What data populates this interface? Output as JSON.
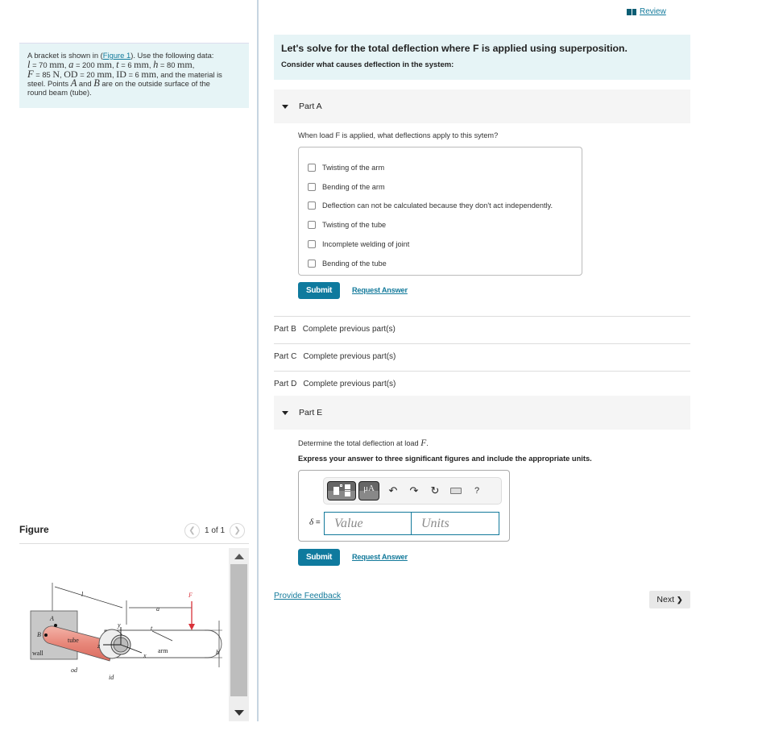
{
  "problem": {
    "prefix": "A bracket is shown in (",
    "figure_link": "Figure 1",
    "suffix": "). Use the following data:",
    "line2": [
      {
        "sym": "l",
        "val": " = 70 ",
        "unit": "mm",
        "sep": ", "
      },
      {
        "sym": "a",
        "val": " = 200 ",
        "unit": "mm",
        "sep": ", "
      },
      {
        "sym": "t",
        "val": " = 6 ",
        "unit": "mm",
        "sep": ", "
      },
      {
        "sym": "h",
        "val": " = 80 ",
        "unit": "mm",
        "sep": ","
      }
    ],
    "F_sym": "F",
    "F_val": " = 85 ",
    "F_unit": "N",
    "OD_sym": "OD",
    "OD_val": " = 20 ",
    "OD_unit": "mm",
    "ID_sym": "ID",
    "ID_val": " = 6 ",
    "ID_unit": "mm",
    "line3_tail": ", and the material is",
    "line4_a": "steel. Points ",
    "A_sym": "A",
    "and": " and ",
    "B_sym": "B",
    "line4_b": " are on the outside surface of the",
    "line5": "round beam (tube)."
  },
  "figure": {
    "title": "Figure",
    "counter": "1 of 1",
    "labels": {
      "wall": "wall",
      "tube": "tube",
      "arm": "arm",
      "A": "A",
      "B": "B",
      "l": "l",
      "a": "a",
      "F": "F",
      "t": "t",
      "h": "h",
      "y": "y",
      "x": "x",
      "z": "z",
      "od": "od",
      "id": "id"
    }
  },
  "header": {
    "review_label": "Review"
  },
  "intro": {
    "title": "Let's solve for the total deflection where F is applied using superposition.",
    "subtitle": "Consider what causes deflection in the system:"
  },
  "partA": {
    "label": "Part A",
    "question": "When load F is applied, what deflections apply to this sytem?",
    "choices": [
      {
        "label": "Twisting of the arm",
        "checked": false
      },
      {
        "label": "Bending of the arm",
        "checked": false
      },
      {
        "label": "Deflection can not be calculated because they don't act independently.",
        "checked": false
      },
      {
        "label": "Twisting of the tube",
        "checked": false
      },
      {
        "label": "Incomplete welding of joint",
        "checked": false
      },
      {
        "label": "Bending of the tube",
        "checked": false
      }
    ],
    "submit": "Submit",
    "request_answer": "Request Answer"
  },
  "locked_parts": [
    {
      "label": "Part B",
      "status": "Complete previous part(s)"
    },
    {
      "label": "Part C",
      "status": "Complete previous part(s)"
    },
    {
      "label": "Part D",
      "status": "Complete previous part(s)"
    }
  ],
  "partE": {
    "label": "Part E",
    "question_prefix": "Determine the total deflection at load ",
    "question_sym": "F",
    "question_suffix": ".",
    "instruction": "Express your answer to three significant figures and include the appropriate units.",
    "toolbar": {
      "templates_icon": "templates-icon",
      "units_label": "μA",
      "undo_icon": "↶",
      "redo_icon": "↷",
      "reset_icon": "↻",
      "keyboard_icon": "keyboard-icon",
      "help_label": "?"
    },
    "variable": "δ",
    "equals": " =",
    "value_placeholder": "Value",
    "units_placeholder": "Units",
    "value": "",
    "units": "",
    "submit": "Submit",
    "request_answer": "Request Answer"
  },
  "footer": {
    "feedback": "Provide Feedback",
    "next": "Next",
    "next_icon": "❯"
  },
  "colors": {
    "accent": "#0f7a9e",
    "link": "#137a9b",
    "intro_bg": "#e6f4f6",
    "part_header_bg": "#f5f5f5",
    "force_arrow": "#d9323a",
    "tube": "#e8877a"
  }
}
